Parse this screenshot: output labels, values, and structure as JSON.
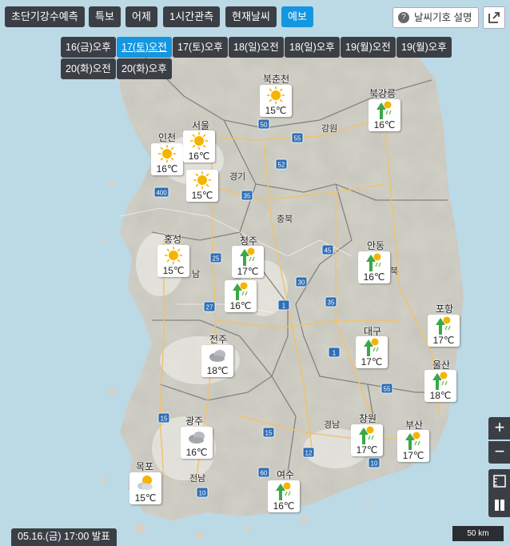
{
  "top_tabs": [
    {
      "label": "초단기강수예측",
      "active": false
    },
    {
      "label": "특보",
      "active": false
    },
    {
      "label": "어제",
      "active": false
    },
    {
      "label": "1시간관측",
      "active": false
    },
    {
      "label": "현재날씨",
      "active": false
    },
    {
      "label": "예보",
      "active": true
    }
  ],
  "legend_button": {
    "label": "날씨기호 설명",
    "icon": "question-icon"
  },
  "external_button": {
    "icon": "external-link-icon"
  },
  "time_chips": [
    {
      "label": "16(금)오후",
      "active": false
    },
    {
      "label": "17(토)오전",
      "active": true
    },
    {
      "label": "17(토)오후",
      "active": false
    },
    {
      "label": "18(일)오전",
      "active": false
    },
    {
      "label": "18(일)오후",
      "active": false
    },
    {
      "label": "19(월)오전",
      "active": false
    },
    {
      "label": "19(월)오후",
      "active": false
    },
    {
      "label": "20(화)오전",
      "active": false
    },
    {
      "label": "20(화)오후",
      "active": false
    }
  ],
  "provinces": [
    {
      "label": "강원"
    },
    {
      "label": "경기"
    },
    {
      "label": "충북"
    },
    {
      "label": "남"
    },
    {
      "label": "북"
    },
    {
      "label": "경남"
    },
    {
      "label": "전남"
    }
  ],
  "cities": [
    {
      "name": "북춘천",
      "temp": "15℃",
      "icon": "sunny-icon"
    },
    {
      "name": "북강릉",
      "temp": "16℃",
      "icon": "rain-shower-icon"
    },
    {
      "name": "인천",
      "temp": "16℃",
      "icon": "sunny-icon"
    },
    {
      "name": "서울",
      "temp": "16℃",
      "icon": "sunny-icon"
    },
    {
      "name": "",
      "temp": "15℃",
      "icon": "sunny-icon"
    },
    {
      "name": "홍성",
      "temp": "15℃",
      "icon": "sunny-icon"
    },
    {
      "name": "청주",
      "temp": "17℃",
      "icon": "rain-shower-icon"
    },
    {
      "name": "",
      "temp": "16℃",
      "icon": "rain-shower-icon"
    },
    {
      "name": "안동",
      "temp": "16℃",
      "icon": "rain-shower-icon"
    },
    {
      "name": "포항",
      "temp": "17℃",
      "icon": "rain-shower-icon"
    },
    {
      "name": "대구",
      "temp": "17℃",
      "icon": "rain-shower-icon"
    },
    {
      "name": "울산",
      "temp": "18℃",
      "icon": "rain-shower-icon"
    },
    {
      "name": "전주",
      "temp": "18℃",
      "icon": "cloudy-icon"
    },
    {
      "name": "광주",
      "temp": "16℃",
      "icon": "cloudy-icon"
    },
    {
      "name": "창원",
      "temp": "17℃",
      "icon": "rain-shower-icon"
    },
    {
      "name": "부산",
      "temp": "17℃",
      "icon": "rain-shower-icon"
    },
    {
      "name": "목포",
      "temp": "15℃",
      "icon": "partly-cloudy-icon"
    },
    {
      "name": "여수",
      "temp": "16℃",
      "icon": "rain-shower-icon"
    }
  ],
  "highways": [
    "55",
    "50",
    "52",
    "35",
    "400",
    "25",
    "45",
    "30",
    "1",
    "35",
    "27",
    "15",
    "55",
    "10",
    "12",
    "60",
    "1",
    "15",
    "10"
  ],
  "zoom_in": {
    "label": "+"
  },
  "zoom_out": {
    "label": "−"
  },
  "issued": "05.16.(금) 17:00 발표",
  "scale": "50 km",
  "colors": {
    "land": "#d4d2c8",
    "sea": "#bcd9e6",
    "button": "#3b3f45",
    "active": "#1496e0",
    "sun": "#f5b400",
    "rain": "#3aa848"
  }
}
